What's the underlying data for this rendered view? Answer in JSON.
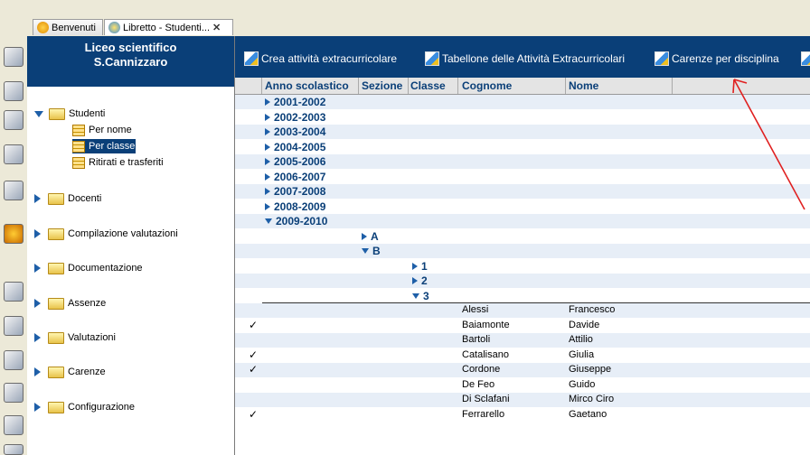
{
  "tabs": [
    {
      "label": "Benvenuti",
      "icon": "welcome-icon",
      "active": false
    },
    {
      "label": "Libretto - Studenti...",
      "icon": "libretto-icon",
      "active": true
    }
  ],
  "header": {
    "line1": "Liceo scientifico",
    "line2": "S.Cannizzaro"
  },
  "tree": {
    "studenti": "Studenti",
    "per_nome": "Per nome",
    "per_classe": "Per classe",
    "ritirati": "Ritirati e trasferiti",
    "docenti": "Docenti",
    "compilazione": "Compilazione valutazioni",
    "documentazione": "Documentazione",
    "assenze": "Assenze",
    "valutazioni": "Valutazioni",
    "carenze": "Carenze",
    "configurazione": "Configurazione"
  },
  "toolbar": {
    "crea": "Crea attività extracurricolare",
    "tabellone": "Tabellone delle Attività Extracurricolari",
    "carenze": "Carenze per disciplina"
  },
  "columns": {
    "anno": "Anno scolastico",
    "sezione": "Sezione",
    "classe": "Classe",
    "cognome": "Cognome",
    "nome": "Nome"
  },
  "years": [
    "2001-2002",
    "2002-2003",
    "2003-2004",
    "2004-2005",
    "2005-2006",
    "2006-2007",
    "2007-2008",
    "2008-2009",
    "2009-2010"
  ],
  "sections": [
    "A",
    "B"
  ],
  "classes": [
    "1",
    "2",
    "3"
  ],
  "students": [
    {
      "cognome": "Alessi",
      "nome": "Francesco",
      "check": ""
    },
    {
      "cognome": "Baiamonte",
      "nome": "Davide",
      "check": "✓"
    },
    {
      "cognome": "Bartoli",
      "nome": "Attilio",
      "check": ""
    },
    {
      "cognome": "Catalisano",
      "nome": "Giulia",
      "check": "✓"
    },
    {
      "cognome": "Cordone",
      "nome": "Giuseppe",
      "check": "✓"
    },
    {
      "cognome": "De Feo",
      "nome": "Guido",
      "check": ""
    },
    {
      "cognome": "Di Sclafani",
      "nome": "Mirco Ciro",
      "check": ""
    },
    {
      "cognome": "Ferrarello",
      "nome": "Gaetano",
      "check": "✓"
    }
  ],
  "colors": {
    "navy": "#0A3F78",
    "row_alt": "#E7EEF7",
    "arrow": "#E02020"
  }
}
